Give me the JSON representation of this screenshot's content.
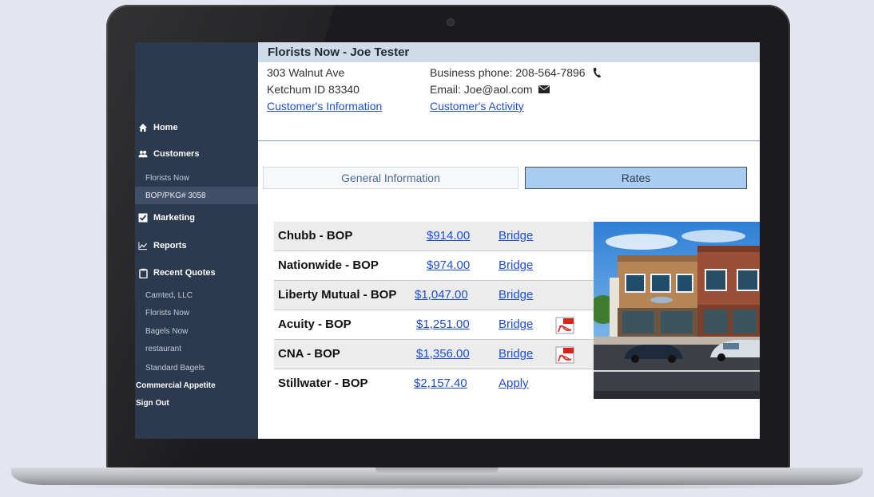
{
  "sidebar": {
    "nav": [
      {
        "label": "Home",
        "icon": "home-icon"
      },
      {
        "label": "Customers",
        "icon": "users-icon"
      },
      {
        "label": "Marketing",
        "icon": "checkbox-icon"
      },
      {
        "label": "Reports",
        "icon": "chart-icon"
      },
      {
        "label": "Recent Quotes",
        "icon": "clipboard-icon"
      }
    ],
    "customer_items": [
      "Florists Now",
      "BOP/PKG# 3058"
    ],
    "recent_quotes": [
      "Camted, LLC",
      "Florists Now",
      "Bagels Now",
      "restaurant",
      "Standard Bagels"
    ],
    "commercial_appetite": "Commercial Appetite",
    "sign_out": "Sign Out"
  },
  "header": {
    "title": "Florists Now - Joe Tester",
    "address_line1": "303 Walnut Ave",
    "address_line2": "Ketchum ID 83340",
    "customer_info_link": "Customer's Information",
    "business_phone": "Business phone: 208-564-7896",
    "email": "Email: Joe@aol.com",
    "customer_activity_link": "Customer's Activity"
  },
  "tabs": {
    "general": "General Information",
    "rates": "Rates"
  },
  "rates": [
    {
      "carrier": "Chubb - BOP",
      "price": "$914.00",
      "action": "Bridge",
      "pdf": false
    },
    {
      "carrier": "Nationwide - BOP",
      "price": "$974.00",
      "action": "Bridge",
      "pdf": false
    },
    {
      "carrier": "Liberty Mutual - BOP",
      "price": "$1,047.00",
      "action": "Bridge",
      "pdf": false
    },
    {
      "carrier": "Acuity - BOP",
      "price": "$1,251.00",
      "action": "Bridge",
      "pdf": true
    },
    {
      "carrier": "CNA - BOP",
      "price": "$1,356.00",
      "action": "Bridge",
      "pdf": true
    },
    {
      "carrier": "Stillwater - BOP",
      "price": "$2,157.40",
      "action": "Apply",
      "pdf": false
    }
  ],
  "colors": {
    "sidebar_bg": "#2b3a4f",
    "active_item_bg": "#3f5068",
    "title_bar_bg": "#cfdbe8",
    "link": "#1f4fd1",
    "rates_tab_bg": "#a9ccf0"
  }
}
